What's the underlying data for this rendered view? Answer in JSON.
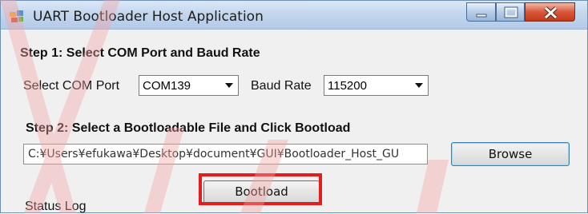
{
  "window": {
    "title": "UART Bootloader Host Application"
  },
  "step1": {
    "heading": "Step 1: Select COM Port and Baud Rate",
    "com_label": "Select COM Port",
    "com_value": "COM139",
    "baud_label": "Baud Rate",
    "baud_value": "115200"
  },
  "step2": {
    "heading": "Step 2: Select a Bootloadable File and Click Bootload",
    "file_path": "C:¥Users¥efukawa¥Desktop¥document¥GUI¥Bootloader_Host_GU",
    "browse_label": "Browse",
    "bootload_label": "Bootload"
  },
  "status": {
    "label": "Status Log"
  },
  "colors": {
    "highlight": "#e11d1d",
    "watermark": "#f4a3a3",
    "titlebar": "#c4d7ee"
  },
  "icons": [
    "app-icon",
    "minimize-icon",
    "maximize-icon",
    "close-icon",
    "dropdown-arrow-icon"
  ]
}
